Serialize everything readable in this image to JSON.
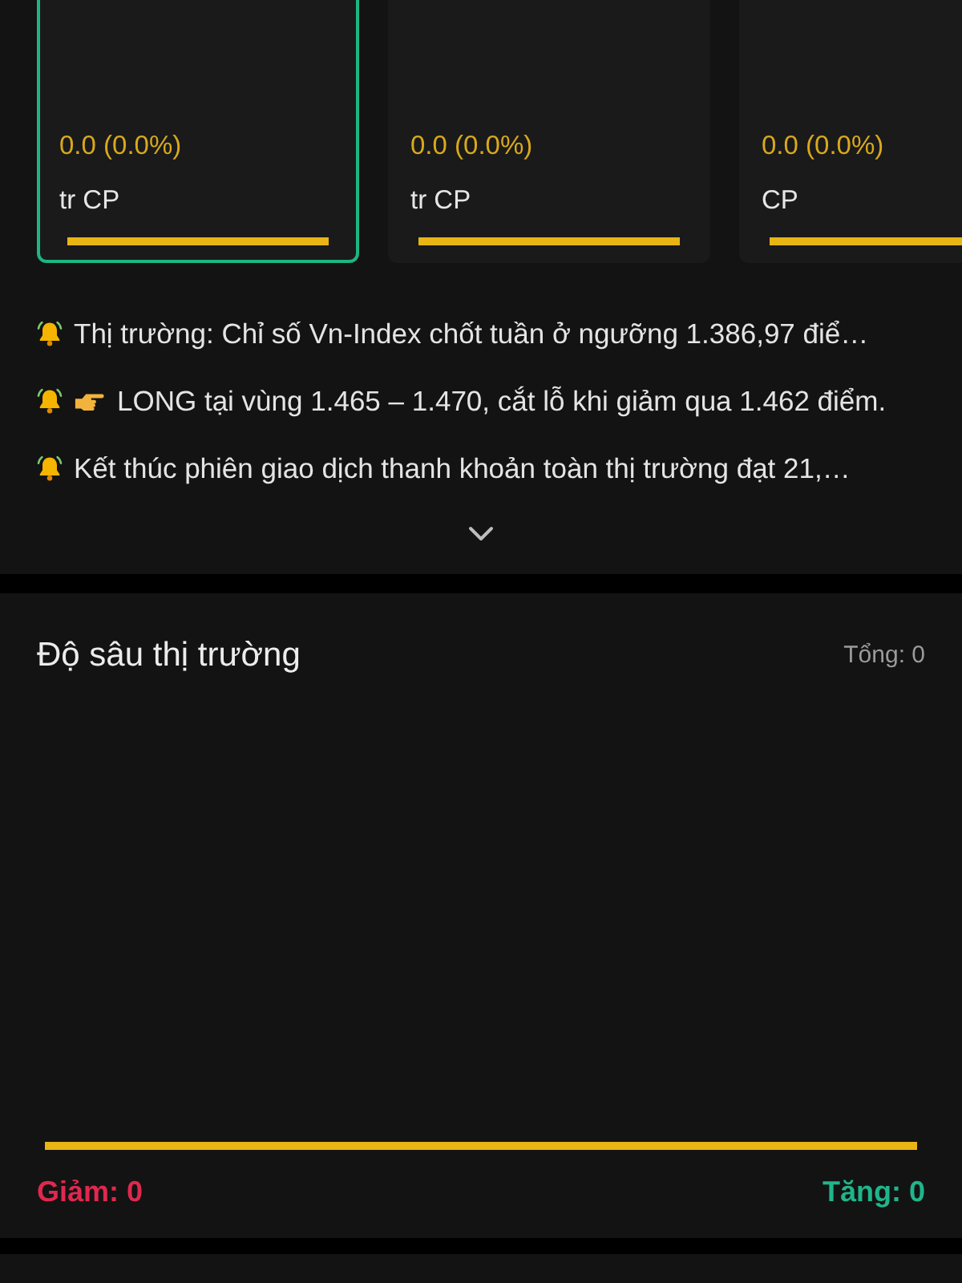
{
  "index_cards": [
    {
      "change": "0.0 (0.0%)",
      "volume": "tr CP",
      "selected": true
    },
    {
      "change": "0.0 (0.0%)",
      "volume": "tr CP",
      "selected": false
    },
    {
      "change": "0.0 (0.0%)",
      "volume": "CP",
      "selected": false
    }
  ],
  "announcements": {
    "expanded": false,
    "items": [
      {
        "kind": "bell",
        "text": "Thị trường: Chỉ số Vn-Index chốt tuần ở ngưỡng 1.386,97 điể…"
      },
      {
        "kind": "bell-pointing",
        "text": "LONG tại vùng 1.465 – 1.470, cắt lỗ khi giảm qua 1.462 điểm."
      },
      {
        "kind": "bell",
        "text": "Kết thúc phiên giao dịch thanh khoản toàn thị trường đạt 21,…"
      }
    ]
  },
  "market_depth": {
    "title": "Độ sâu thị trường",
    "total": "Tổng: 0",
    "decrease": "Giảm: 0",
    "increase": "Tăng: 0"
  }
}
